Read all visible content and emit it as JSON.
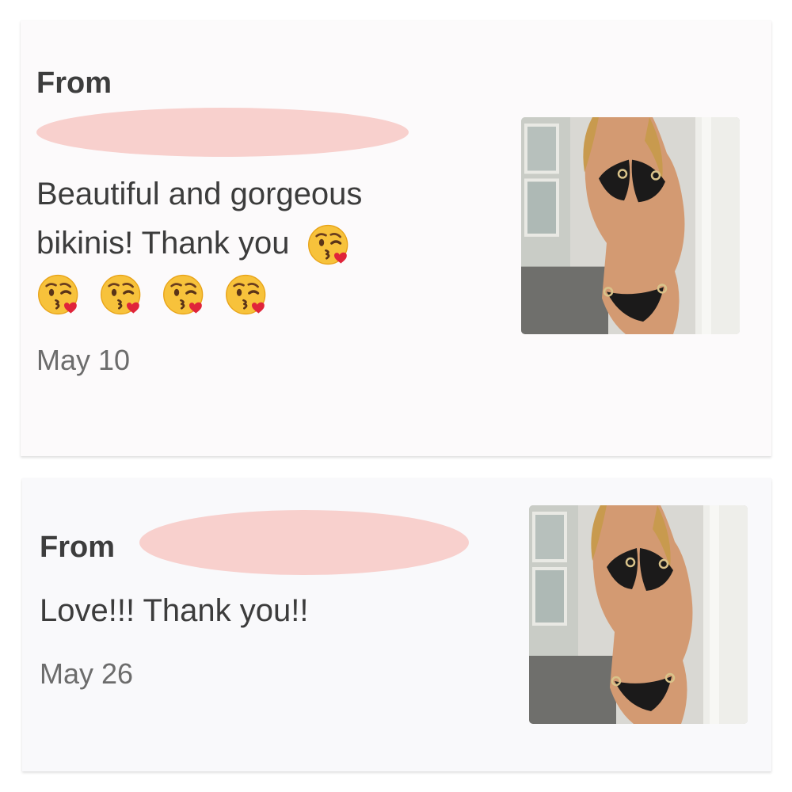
{
  "reviews": [
    {
      "from_label": "From",
      "message_line1": "Beautiful and gorgeous",
      "message_line2": "bikinis! Thank you",
      "emoji_icon": "kissing-face-icon",
      "emoji_count_line2": 1,
      "emoji_count_line3": 4,
      "date": "May 10",
      "photo_icon": "product-photo-bikini"
    },
    {
      "from_label": "From",
      "message": "Love!!! Thank you!!",
      "date": "May 26",
      "photo_icon": "product-photo-bikini"
    }
  ],
  "colors": {
    "redaction": "#f8d0cd",
    "text": "#3c3c3c",
    "date": "#6c6c6c",
    "card": "#fcfafb"
  }
}
